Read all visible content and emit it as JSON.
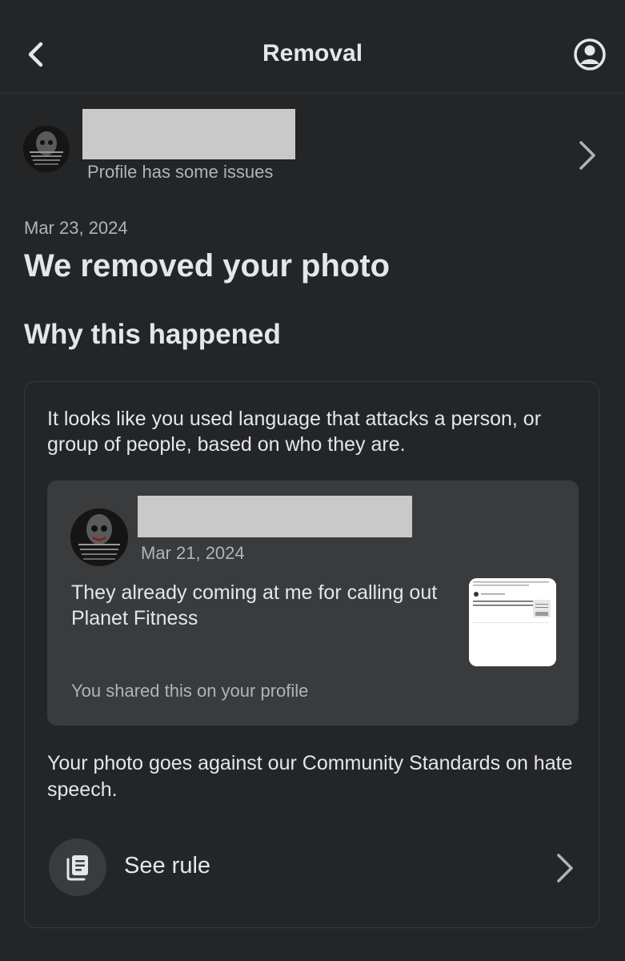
{
  "header": {
    "title": "Removal"
  },
  "profile": {
    "subtitle": "Profile has some issues"
  },
  "notice": {
    "date": "Mar 23, 2024",
    "headline": "We removed your photo",
    "section_title": "Why this happened"
  },
  "card": {
    "reason": "It looks like you used language that attacks a person, or group of people, based on who they are.",
    "post": {
      "date": "Mar 21, 2024",
      "text": "They already coming at me for calling out Planet Fitness",
      "shared_note": "You shared this on your profile"
    },
    "violation": "Your photo goes against our Community Standards on hate speech.",
    "rule_label": "See rule"
  },
  "icons": {
    "back": "chevron-left-icon",
    "account": "account-circle-icon",
    "row_chevron": "chevron-right-icon",
    "rule": "document-stack-icon"
  },
  "colors": {
    "background": "#242526",
    "card_inner": "#3a3b3c",
    "text_primary": "#e4e6eb",
    "text_secondary": "#b0b3b8",
    "redaction": "#c9c9c9"
  }
}
